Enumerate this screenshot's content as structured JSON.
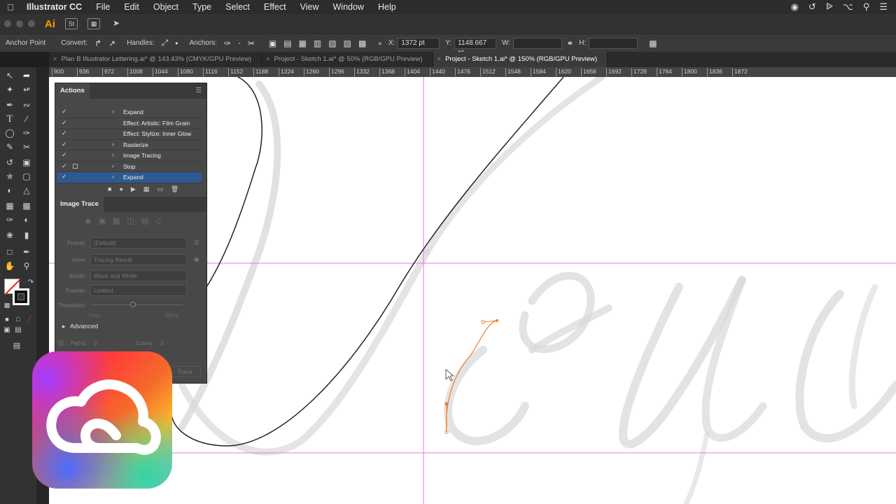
{
  "menubar": {
    "app_name": "Illustrator CC",
    "items": [
      "File",
      "Edit",
      "Object",
      "Type",
      "Select",
      "Effect",
      "View",
      "Window",
      "Help"
    ]
  },
  "appbar": {
    "logo": "Ai",
    "stock_label": "St"
  },
  "controlbar": {
    "selection_label": "Anchor Point",
    "convert_label": "Convert:",
    "handles_label": "Handles:",
    "anchors_label": "Anchors:",
    "x_label": "X:",
    "x_value": "1372 pt",
    "y_label": "Y:",
    "y_value": "1148.667 pt",
    "w_label": "W:",
    "h_label": "H:"
  },
  "tabs": [
    {
      "label": "Plan B Illustrator Lettering.ai* @ 143.43% (CMYK/GPU Preview)",
      "active": false
    },
    {
      "label": "Project - Sketch 1.ai* @ 50% (RGB/GPU Preview)",
      "active": false
    },
    {
      "label": "Project - Sketch 1.ai* @ 150% (RGB/GPU Preview)",
      "active": true
    }
  ],
  "ruler": {
    "ticks": [
      "900",
      "936",
      "972",
      "1008",
      "1044",
      "1080",
      "1116",
      "1152",
      "1188",
      "1224",
      "1260",
      "1296",
      "1332",
      "1368",
      "1404",
      "1440",
      "1476",
      "1512",
      "1548",
      "1584",
      "1620",
      "1656",
      "1692",
      "1728",
      "1764",
      "1800",
      "1836",
      "1872"
    ]
  },
  "actions_panel": {
    "title": "Actions",
    "rows": [
      {
        "name": "Expand",
        "checked": true,
        "dialog": false,
        "expandable": true,
        "selected": false
      },
      {
        "name": "Effect: Artistic: Film Grain",
        "checked": true,
        "dialog": false,
        "expandable": false,
        "selected": false
      },
      {
        "name": "Effect: Stylize: Inner Glow",
        "checked": true,
        "dialog": false,
        "expandable": false,
        "selected": false
      },
      {
        "name": "Rasterize",
        "checked": true,
        "dialog": false,
        "expandable": true,
        "selected": false
      },
      {
        "name": "Image Tracing",
        "checked": true,
        "dialog": false,
        "expandable": true,
        "selected": false
      },
      {
        "name": "Stop",
        "checked": true,
        "dialog": true,
        "expandable": true,
        "selected": false
      },
      {
        "name": "Expand",
        "checked": true,
        "dialog": false,
        "expandable": true,
        "selected": true
      }
    ]
  },
  "image_trace_panel": {
    "title": "Image Trace",
    "preset_label": "Preset:",
    "preset_value": "[Default]",
    "view_label": "View:",
    "view_value": "Tracing Result",
    "mode_label": "Mode:",
    "mode_value": "Black and White",
    "palette_label": "Palette:",
    "palette_value": "Limited",
    "threshold_label": "Threshold:",
    "less_label": "Less",
    "more_label": "More",
    "advanced_label": "Advanced",
    "paths_label": "Paths:",
    "paths_value": "0",
    "colors_label": "Colors:",
    "colors_value": "0",
    "trace_button": "Trace"
  },
  "colors": {
    "guide": "#d982d9",
    "path_selected": "#f07f2c",
    "selection_blue": "#2e5a8f",
    "sketch": "#d6d6d6"
  }
}
